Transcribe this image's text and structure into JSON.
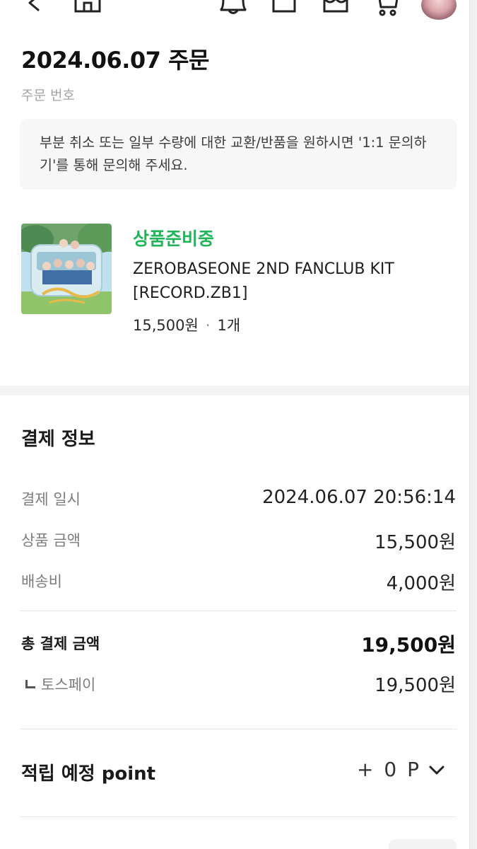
{
  "header": {
    "icons": [
      "back-arrow-icon",
      "home-icon",
      "bell-icon",
      "bookmark-icon",
      "shop-icon",
      "cart-icon"
    ],
    "avatar": "profile-avatar"
  },
  "order": {
    "title": "2024.06.07 주문",
    "order_number_label": "주문 번호"
  },
  "notice": {
    "text": "부분 취소 또는 일부 수량에 대한 교환/반품을 원하시면 '1:1 문의하기'를 통해 문의해 주세요."
  },
  "product": {
    "status": "상품준비중",
    "name": "ZEROBASEONE 2ND FANCLUB KIT [RECORD.ZB1]",
    "price": "15,500원",
    "quantity": "1개",
    "status_color": "#22b45a"
  },
  "payment": {
    "title": "결제 정보",
    "rows": [
      {
        "label": "결제 일시",
        "value": "2024.06.07 20:56:14"
      },
      {
        "label": "상품 금액",
        "value": "15,500원"
      },
      {
        "label": "배송비",
        "value": "4,000원"
      }
    ],
    "total_label": "총 결제 금액",
    "total_value": "19,500원",
    "method_label": "토스페이",
    "method_value": "19,500원"
  },
  "points": {
    "label": "적립 예정 point",
    "value": "+ 0 P"
  }
}
